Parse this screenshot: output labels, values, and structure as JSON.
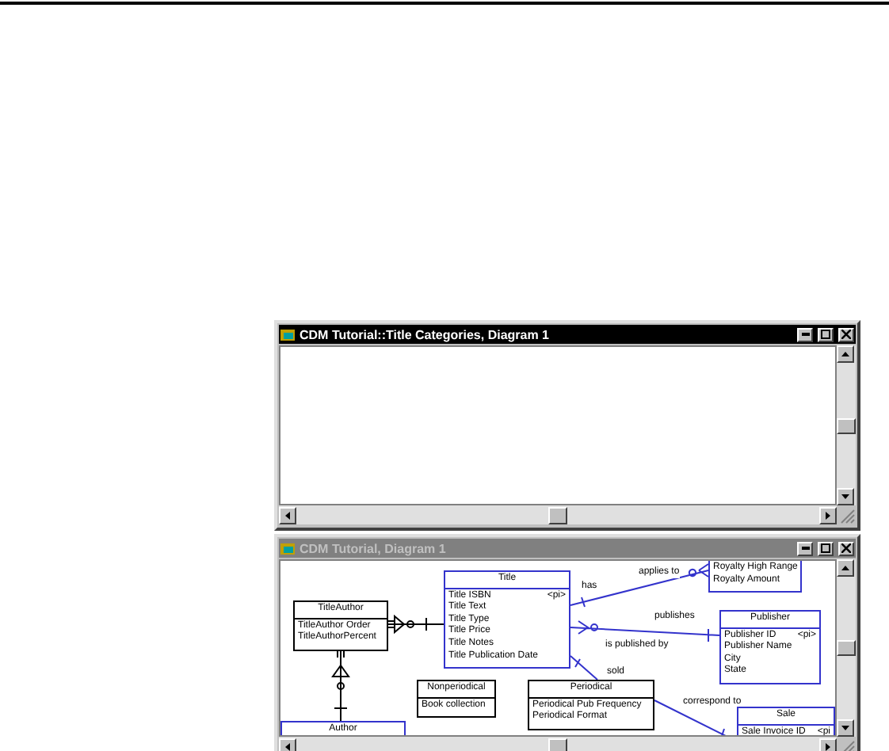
{
  "windows": [
    {
      "title": "CDM Tutorial::Title Categories, Diagram 1",
      "active": true
    },
    {
      "title": "CDM Tutorial, Diagram 1",
      "active": false,
      "entities": [
        {
          "name": "Author",
          "selected": true
        },
        {
          "name": "TitleAuthor",
          "selected": false,
          "attributes": [
            {
              "name": "TitleAuthor Order"
            },
            {
              "name": "TitleAuthorPercent"
            }
          ]
        },
        {
          "name": "Nonperiodical",
          "selected": false,
          "attributes": [
            {
              "name": "Book collection"
            }
          ]
        },
        {
          "name": "Title",
          "selected": true,
          "attributes": [
            {
              "name": "Title ISBN",
              "tag": "<pi>"
            },
            {
              "name": "Title Text"
            },
            {
              "name": "Title Type"
            },
            {
              "name": "Title Price"
            },
            {
              "name": "Title Notes"
            },
            {
              "name": "Title Publication Date"
            }
          ]
        },
        {
          "name": "Periodical",
          "selected": false,
          "attributes": [
            {
              "name": "Periodical Pub Frequency"
            },
            {
              "name": "Periodical Format"
            }
          ]
        },
        {
          "selected": true,
          "attributes": [
            {
              "name": "Royalty High Range"
            },
            {
              "name": "Royalty Amount"
            }
          ]
        },
        {
          "name": "Publisher",
          "selected": true,
          "attributes": [
            {
              "name": "Publisher ID",
              "tag": "<pi>"
            },
            {
              "name": "Publisher Name"
            },
            {
              "name": "City"
            },
            {
              "name": "State"
            }
          ]
        },
        {
          "name": "Sale",
          "selected": true,
          "attributes": [
            {
              "name": "Sale Invoice ID",
              "tag": "<pi"
            }
          ]
        }
      ],
      "relationship_labels": [
        "has",
        "applies to",
        "publishes",
        "is published by",
        "sold",
        "correspond to"
      ]
    }
  ]
}
